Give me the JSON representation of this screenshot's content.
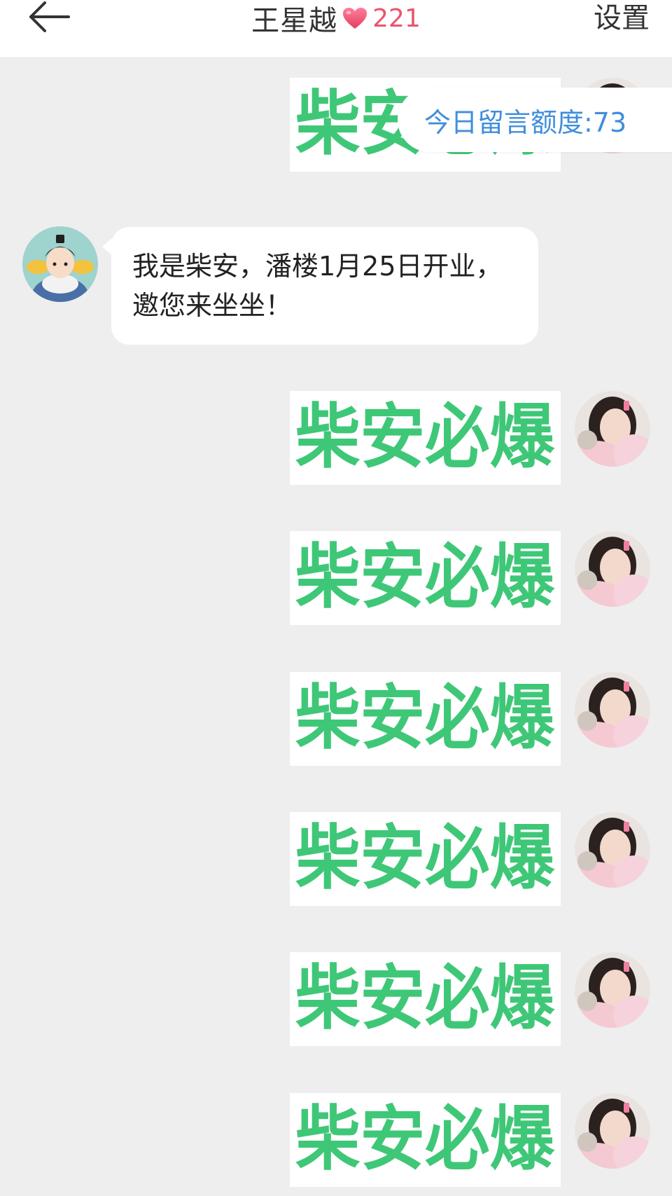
{
  "header": {
    "back_icon": "back-arrow-icon",
    "title": "王星越",
    "heart_icon": "heart-icon",
    "heart_color": "#e9556d",
    "intimacy": "221",
    "settings_label": "设置"
  },
  "quota": {
    "label": "今日留言额度:73",
    "color": "#3f8edc"
  },
  "incoming_message": {
    "text": "我是柴安，潘楼1月25日开业，邀您来坐坐！"
  },
  "sticker": {
    "text": "柴安必爆",
    "color": "#3fc778"
  },
  "outgoing_sticker_count": 7
}
